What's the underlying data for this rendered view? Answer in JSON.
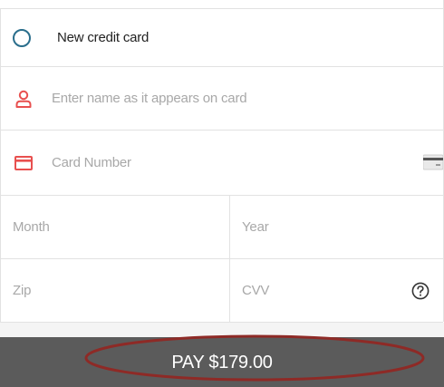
{
  "card_option": {
    "label": "New credit card"
  },
  "fields": {
    "name_placeholder": "Enter name as it appears on card",
    "number_placeholder": "Card Number",
    "month_placeholder": "Month",
    "year_placeholder": "Year",
    "zip_placeholder": "Zip",
    "cvv_placeholder": "CVV"
  },
  "icons": {
    "radio": "radio-unselected-icon",
    "name": "user-icon",
    "number": "credit-card-icon",
    "card_type": "card-chip-icon",
    "cvv_help": "help-circle-icon"
  },
  "pay_button": {
    "label": "PAY $179.00"
  },
  "colors": {
    "accent_red": "#e8504f",
    "radio_blue": "#2a6e8c",
    "pay_bar": "#5b5b5b",
    "highlight_ellipse": "#8e2a26",
    "placeholder_text": "#a8a8a8"
  }
}
